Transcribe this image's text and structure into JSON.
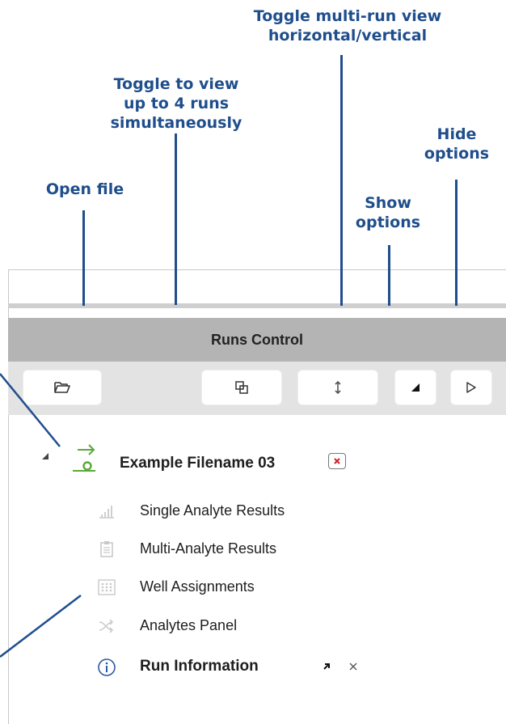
{
  "callouts": {
    "open_file": "Open file",
    "toggle_view_line1": "Toggle to view",
    "toggle_view_line2": "up to 4 runs",
    "toggle_view_line3": "simultaneously",
    "toggle_multi_line1": "Toggle multi-run view",
    "toggle_multi_line2": "horizontal/vertical",
    "show_line1": "Show",
    "show_line2": "options",
    "hide_line1": "Hide",
    "hide_line2": "options"
  },
  "panel": {
    "title": "Runs Control",
    "toolbar": {
      "open_icon": "folder-open-icon",
      "multi_view_icon": "overlapping-windows-icon",
      "orientation_icon": "vertical-arrows-icon",
      "show_icon": "filled-triangle-icon",
      "hide_icon": "play-outline-icon"
    }
  },
  "tree": {
    "run": {
      "filename": "Example Filename 03",
      "remove_icon": "close-red-icon"
    },
    "items": [
      {
        "label": "Single Analyte Results",
        "icon": "bar-chart-icon"
      },
      {
        "label": "Multi-Analyte Results",
        "icon": "clipboard-icon"
      },
      {
        "label": "Well Assignments",
        "icon": "grid-icon"
      },
      {
        "label": "Analytes Panel",
        "icon": "shuffle-icon"
      },
      {
        "label": "Run Information",
        "icon": "info-icon",
        "bold": true
      }
    ]
  },
  "colors": {
    "callout": "#1f4e8c",
    "header_bg": "#b4b4b4",
    "toolbar_bg": "#e3e3e3",
    "accent_green": "#5aa83a",
    "remove_red": "#d0202a"
  }
}
